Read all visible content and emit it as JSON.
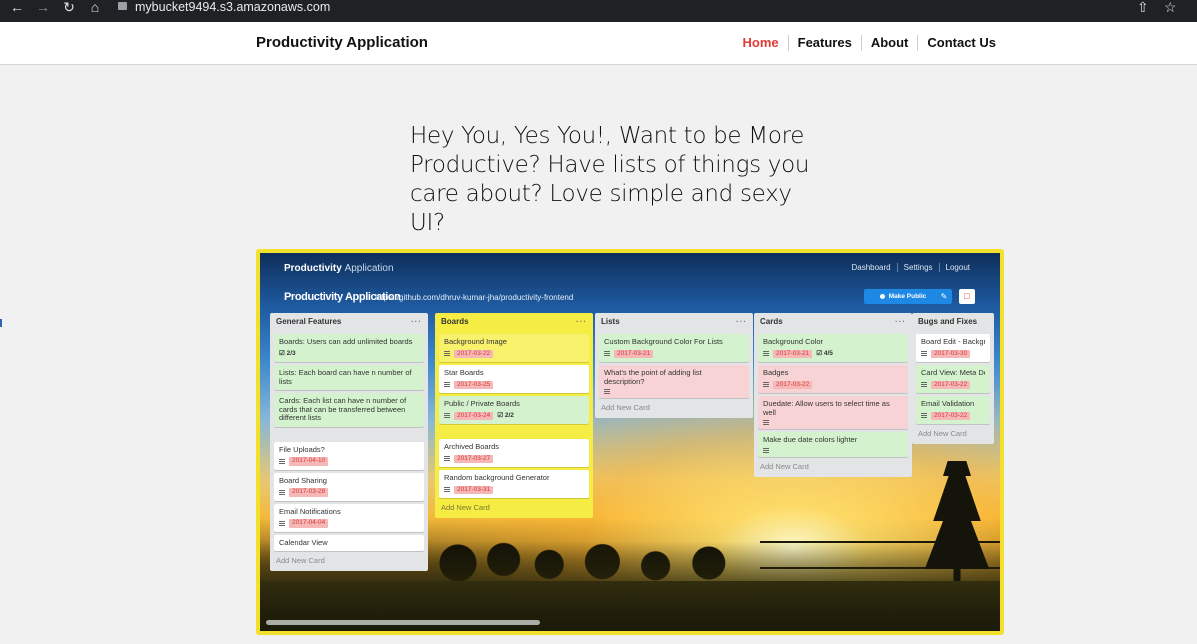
{
  "browser": {
    "url": "mybucket9494.s3.amazonaws.com",
    "icons": [
      "back-icon",
      "forward-icon",
      "reload-icon",
      "home-icon",
      "lock-icon",
      "share-icon",
      "star-icon"
    ]
  },
  "site": {
    "brand": "Productivity Application",
    "nav": [
      "Home",
      "Features",
      "About",
      "Contact Us"
    ],
    "active_color": "#e53935"
  },
  "hero": {
    "text": "Hey You, Yes You!, Want to be More Productive? Have lists of things you care about? Love simple and sexy UI?"
  },
  "preview": {
    "frame_color": "#f3e02b",
    "brand_bold": "Productivity",
    "brand_light": "Application",
    "nav": [
      "Dashboard",
      "Settings",
      "Logout"
    ],
    "board_title": "Productivity Application",
    "board_url": "https://github.com/dhruv-kumar-jha/productivity-frontend",
    "make_public": "Make Public",
    "lists": [
      {
        "title": "General Features",
        "add": "Add New Card",
        "cards": [
          {
            "text": "Boards: Users can add unlimited boards",
            "color": "green",
            "check": "2/3"
          },
          {
            "text": "Lists: Each board can have n number of lists",
            "color": "green"
          },
          {
            "text": "Cards: Each list can have n number of cards that can be transferred between different lists",
            "color": "green"
          },
          {
            "text": "File Uploads?",
            "date": "2017-04-10"
          },
          {
            "text": "Board Sharing",
            "date": "2017-03-28"
          },
          {
            "text": "Email Notifications",
            "date": "2017-04-04"
          },
          {
            "text": "Calendar View"
          }
        ]
      },
      {
        "title": "Boards",
        "add": "Add New Card",
        "cards": [
          {
            "text": "Background Image",
            "date": "2017-03-22",
            "color": "yellow"
          },
          {
            "text": "Star Boards",
            "date": "2017-03-25"
          },
          {
            "text": "Public / Private Boards",
            "date": "2017-03-24",
            "check": "2/2",
            "color": "green"
          },
          {
            "text": "Archived Boards",
            "date": "2017-03-27"
          },
          {
            "text": "Random background Generator",
            "date": "2017-03-31"
          }
        ]
      },
      {
        "title": "Lists",
        "add": "Add New Card",
        "cards": [
          {
            "text": "Custom Background Color For Lists",
            "date": "2017-03-21",
            "color": "green"
          },
          {
            "text": "What's the point of adding list description?",
            "color": "red"
          }
        ]
      },
      {
        "title": "Cards",
        "add": "Add New Card",
        "cards": [
          {
            "text": "Background Color",
            "date": "2017-03-21",
            "check": "4/5",
            "color": "green"
          },
          {
            "text": "Badges",
            "date": "2017-03-22",
            "color": "red"
          },
          {
            "text": "Duedate: Allow users to select time as well",
            "color": "red"
          },
          {
            "text": "Make due date colors lighter",
            "color": "green"
          }
        ]
      },
      {
        "title": "Bugs and Fixes",
        "add": "Add New Card",
        "cards": [
          {
            "text": "Board Edit - Background Warning",
            "date": "2017-03-30"
          },
          {
            "text": "Card View: Meta De",
            "date": "2017-03-22",
            "color": "green"
          },
          {
            "text": "Email Validation",
            "date": "2017-03-22",
            "color": "green"
          }
        ]
      }
    ]
  }
}
